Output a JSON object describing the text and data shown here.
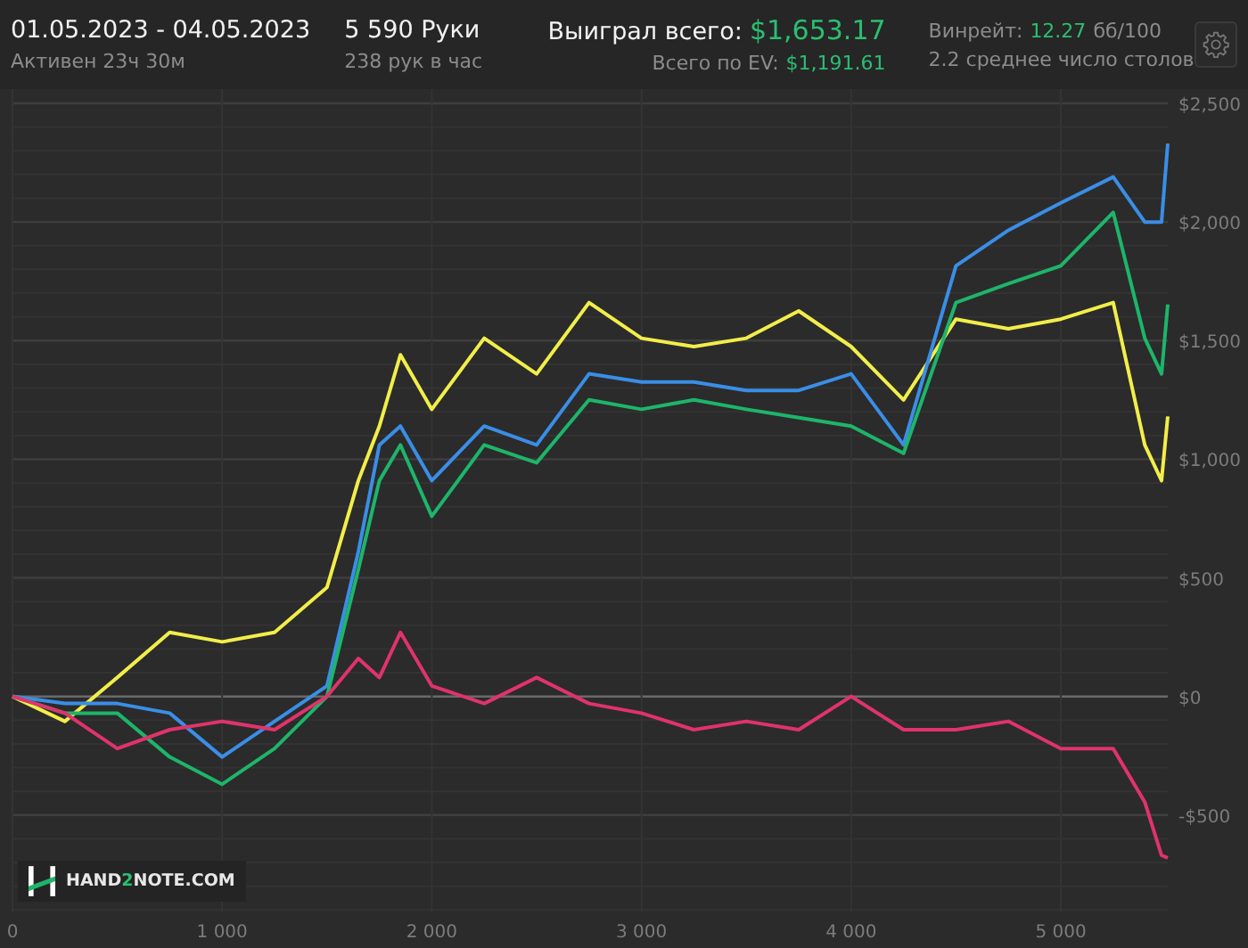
{
  "header": {
    "period": {
      "dates": "01.05.2023 - 04.05.2023",
      "active": "Активен 23ч 30м"
    },
    "hands": {
      "count": "5 590 Руки",
      "rate": "238 рук в час"
    },
    "winnings": {
      "label": "Выиграл всего:",
      "value": "$1,653.17",
      "ev_label": "Всего по EV:",
      "ev_value": "$1,191.61"
    },
    "winrate": {
      "label": "Винрейт:",
      "value": "12.27",
      "unit": "бб/100",
      "tables": "2.2 среднее число столов"
    }
  },
  "chart": {
    "brand": {
      "prefix": "HAND",
      "accent": "2",
      "suffix": "NOTE.COM"
    },
    "chart_data": {
      "type": "line",
      "x": [
        0,
        250,
        500,
        750,
        1000,
        1250,
        1500,
        1650,
        1750,
        1850,
        2000,
        2250,
        2500,
        2750,
        3000,
        3250,
        3500,
        3750,
        4000,
        4250,
        4500,
        4750,
        5000,
        5250,
        5400,
        5480,
        5510
      ],
      "series": [
        {
          "color": "#f2ee4a",
          "values": [
            0,
            -105,
            80,
            270,
            230,
            270,
            460,
            910,
            1140,
            1440,
            1210,
            1510,
            1360,
            1660,
            1510,
            1475,
            1510,
            1625,
            1475,
            1250,
            1590,
            1550,
            1590,
            1660,
            1060,
            910,
            1180
          ]
        },
        {
          "color": "#3a8ee6",
          "values": [
            0,
            -30,
            -30,
            -70,
            -255,
            -105,
            45,
            610,
            1060,
            1140,
            910,
            1140,
            1060,
            1360,
            1325,
            1325,
            1290,
            1290,
            1360,
            1060,
            1815,
            1965,
            2080,
            2190,
            2000,
            2000,
            2330
          ]
        },
        {
          "color": "#1db56a",
          "values": [
            0,
            -70,
            -70,
            -255,
            -370,
            -220,
            0,
            535,
            910,
            1060,
            760,
            1060,
            985,
            1250,
            1210,
            1250,
            1210,
            1175,
            1140,
            1025,
            1660,
            1740,
            1815,
            2040,
            1510,
            1360,
            1653
          ]
        },
        {
          "color": "#e0336b",
          "values": [
            0,
            -70,
            -220,
            -140,
            -105,
            -140,
            0,
            160,
            80,
            270,
            45,
            -30,
            80,
            -30,
            -70,
            -140,
            -105,
            -140,
            0,
            -140,
            -140,
            -105,
            -220,
            -220,
            -445,
            -670,
            -680
          ]
        }
      ],
      "grid": true,
      "xlim": [
        0,
        5510
      ],
      "ylim": [
        -910,
        2560
      ],
      "xticks": [
        {
          "value": 0,
          "label": "0"
        },
        {
          "value": 1000,
          "label": "1 000"
        },
        {
          "value": 2000,
          "label": "2 000"
        },
        {
          "value": 3000,
          "label": "3 000"
        },
        {
          "value": 4000,
          "label": "4 000"
        },
        {
          "value": 5000,
          "label": "5 000"
        }
      ],
      "yticks": [
        {
          "value": -500,
          "label": "-$500"
        },
        {
          "value": 0,
          "label": "$0"
        },
        {
          "value": 500,
          "label": "$500"
        },
        {
          "value": 1000,
          "label": "$1,000"
        },
        {
          "value": 1500,
          "label": "$1,500"
        },
        {
          "value": 2000,
          "label": "$2,000"
        },
        {
          "value": 2500,
          "label": "$2,500"
        }
      ]
    }
  }
}
